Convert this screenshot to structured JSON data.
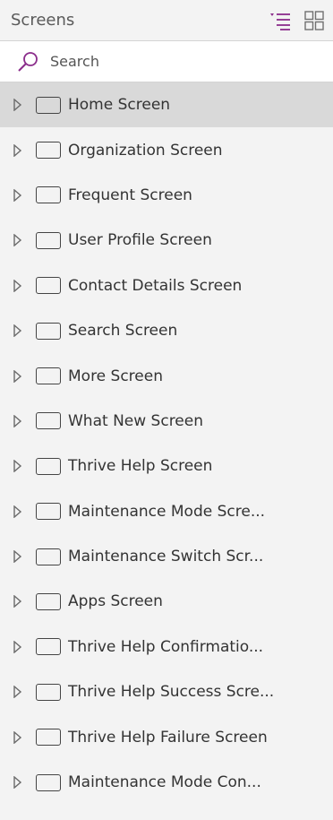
{
  "header": {
    "title": "Screens",
    "tree_view_icon": "tree-list-icon",
    "grid_view_icon": "grid-view-icon",
    "accent_color": "#8b2d8b"
  },
  "search": {
    "placeholder": "Search",
    "value": "",
    "icon": "search-icon",
    "icon_color": "#8b2d8b"
  },
  "screens": [
    {
      "label": "Home Screen",
      "selected": true
    },
    {
      "label": "Organization Screen",
      "selected": false
    },
    {
      "label": "Frequent Screen",
      "selected": false
    },
    {
      "label": "User Profile Screen",
      "selected": false
    },
    {
      "label": "Contact Details Screen",
      "selected": false
    },
    {
      "label": "Search Screen",
      "selected": false
    },
    {
      "label": "More Screen",
      "selected": false
    },
    {
      "label": "What New Screen",
      "selected": false
    },
    {
      "label": "Thrive Help Screen",
      "selected": false
    },
    {
      "label": "Maintenance Mode Scre...",
      "selected": false
    },
    {
      "label": "Maintenance Switch Scr...",
      "selected": false
    },
    {
      "label": "Apps Screen",
      "selected": false
    },
    {
      "label": "Thrive Help Confirmatio...",
      "selected": false
    },
    {
      "label": "Thrive Help Success Scre...",
      "selected": false
    },
    {
      "label": "Thrive Help Failure Screen",
      "selected": false
    },
    {
      "label": "Maintenance Mode Con...",
      "selected": false
    }
  ]
}
